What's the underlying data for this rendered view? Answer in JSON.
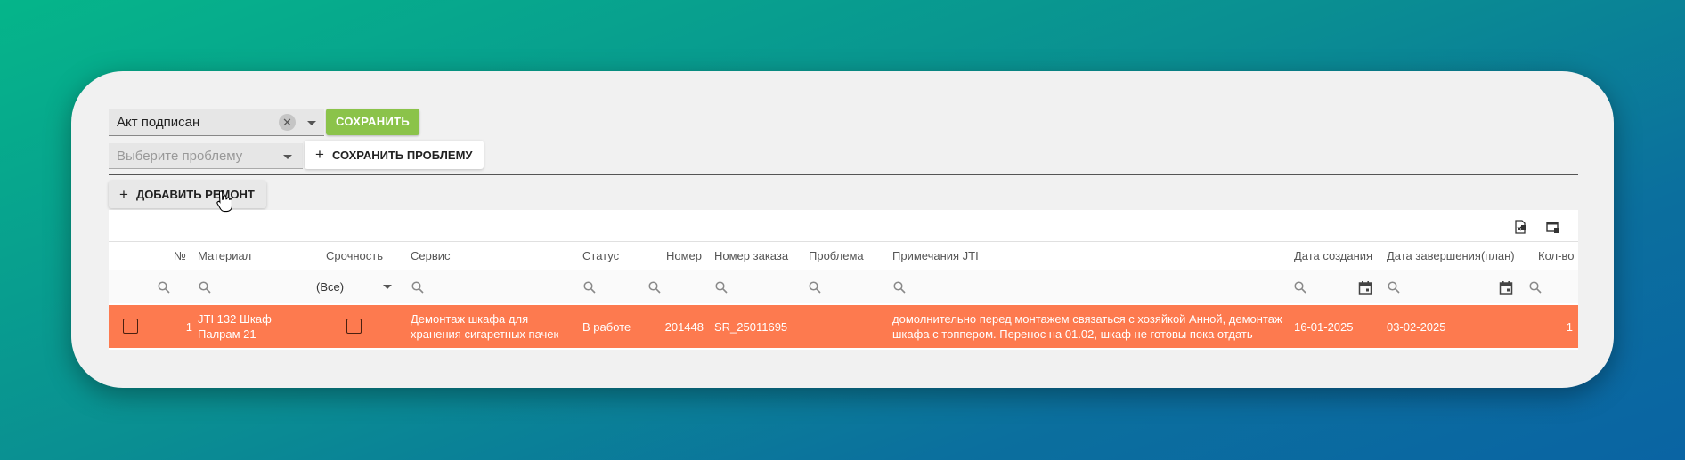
{
  "status": {
    "value": "Акт подписан",
    "clear_icon": "close-icon",
    "arrow_icon": "chevron-down-icon"
  },
  "save_label": "СОХРАНИТЬ",
  "problem": {
    "placeholder": "Выберите проблему",
    "arrow_icon": "chevron-down-icon"
  },
  "save_problem_label": "СОХРАНИТЬ ПРОБЛЕМУ",
  "add_repair_label": "ДОБАВИТЬ РЕМОНТ",
  "plus_glyph": "+",
  "colors": {
    "accent": "#8bc34a",
    "row_highlight": "#fd7a4f"
  },
  "grid": {
    "toolbar_icons": [
      "export-excel-icon",
      "column-chooser-icon"
    ],
    "columns": {
      "num": "№",
      "material": "Материал",
      "urgency": "Срочность",
      "service": "Сервис",
      "status": "Статус",
      "number": "Номер",
      "order_number": "Номер заказа",
      "problem": "Проблема",
      "notes": "Примечания JTI",
      "created": "Дата создания",
      "finish_plan": "Дата завершения(план)",
      "qty": "Кол-во"
    },
    "filter_all": "(Все)",
    "rows": [
      {
        "num": "1",
        "material": "JTI 132 Шкаф Палрам 21",
        "service": "Демонтаж шкафа для хранения сигаретных пачек",
        "status": "В работе",
        "number": "201448",
        "order_number": "SR_25011695",
        "problem": "",
        "notes": "домолнительно перед монтажем связаться с хозяйкой Анной, демонтаж шкафа с топпером. Перенос на 01.02, шкаф не готовы пока отдать",
        "created": "16-01-2025",
        "finish_plan": "03-02-2025",
        "qty": "1"
      }
    ]
  }
}
